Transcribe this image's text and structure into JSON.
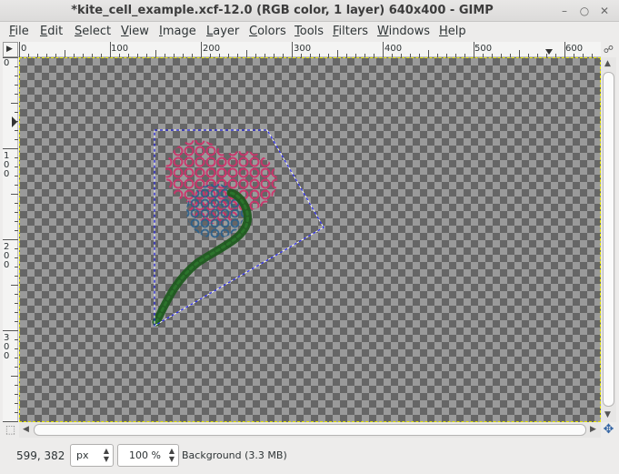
{
  "window": {
    "title": "*kite_cell_example.xcf-12.0 (RGB color, 1 layer) 640x400 - GIMP",
    "min_icon": "minimize-icon",
    "max_icon": "maximize-icon",
    "close_icon": "close-icon"
  },
  "menu": [
    {
      "label": "File",
      "mnemonic": "F",
      "rest": "ile"
    },
    {
      "label": "Edit",
      "mnemonic": "E",
      "rest": "dit"
    },
    {
      "label": "Select",
      "mnemonic": "S",
      "rest": "elect"
    },
    {
      "label": "View",
      "mnemonic": "V",
      "rest": "iew"
    },
    {
      "label": "Image",
      "mnemonic": "I",
      "rest": "mage"
    },
    {
      "label": "Layer",
      "mnemonic": "L",
      "rest": "ayer"
    },
    {
      "label": "Colors",
      "mnemonic": "C",
      "rest": "olors"
    },
    {
      "label": "Tools",
      "mnemonic": "T",
      "rest": "ools"
    },
    {
      "label": "Filters",
      "mnemonic": "F",
      "rest": "ilters"
    },
    {
      "label": "Windows",
      "mnemonic": "W",
      "rest": "indows"
    },
    {
      "label": "Help",
      "mnemonic": "H",
      "rest": "elp"
    }
  ],
  "hruler": {
    "ticks": [
      "0",
      "100",
      "200",
      "300",
      "400",
      "500",
      "600"
    ]
  },
  "vruler": {
    "ticks": [
      "0",
      "100",
      "200",
      "300"
    ]
  },
  "status": {
    "coords": "599, 382",
    "unit": "px",
    "zoom": "100 %",
    "layer_info": "Background (3.3 MB)"
  },
  "colors": {
    "selection": "#1a1aff",
    "pink": "#d0306a",
    "blue": "#2a5f8a",
    "green": "#1f5a1f",
    "canvas_border": "#e6e600"
  }
}
